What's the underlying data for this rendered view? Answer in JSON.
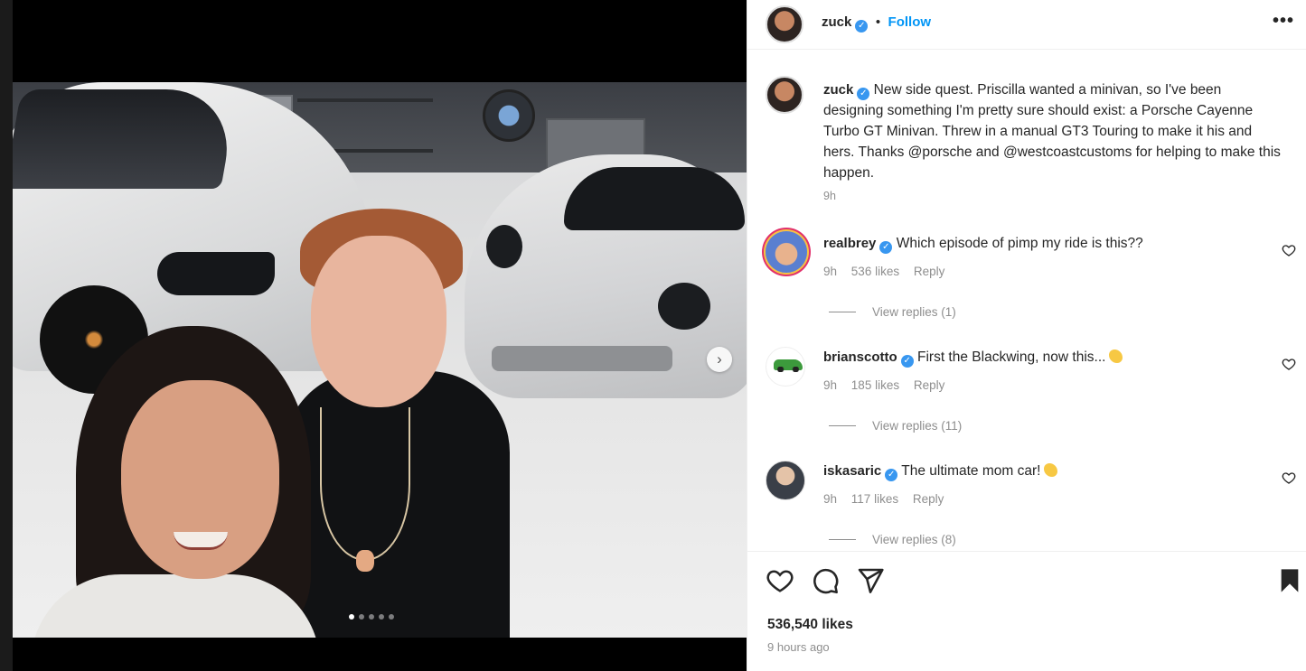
{
  "post": {
    "author": "zuck",
    "follow_separator": "•",
    "follow_label": "Follow",
    "more_label": "•••",
    "caption": "New side quest. Priscilla wanted a minivan, so I've been designing something I'm pretty sure should exist: a Porsche Cayenne Turbo GT Minivan. Threw in a manual GT3 Touring to make it his and hers. Thanks @porsche and @westcoastcustoms for helping to make this happen.",
    "caption_time": "9h",
    "likes": "536,540 likes",
    "time_ago": "9 hours ago"
  },
  "carousel": {
    "next_label": "›",
    "dot_count": 5,
    "active_index": 0
  },
  "comments": [
    {
      "user": "realbrey",
      "text": "Which episode of pimp my ride is this??",
      "time": "9h",
      "likes": "536 likes",
      "reply_label": "Reply",
      "view_replies": "View replies (1)",
      "has_emoji": false
    },
    {
      "user": "brianscotto",
      "text": "First the Blackwing, now this...",
      "time": "9h",
      "likes": "185 likes",
      "reply_label": "Reply",
      "view_replies": "View replies (11)",
      "has_emoji": true
    },
    {
      "user": "iskasaric",
      "text": "The ultimate mom car!",
      "time": "9h",
      "likes": "117 likes",
      "reply_label": "Reply",
      "view_replies": "View replies (8)",
      "has_emoji": true
    }
  ],
  "icons": {
    "verified": "verified-badge-icon",
    "like": "heart-icon",
    "comment": "comment-icon",
    "share": "send-icon",
    "save": "bookmark-icon",
    "carousel_next": "chevron-right-icon"
  },
  "colors": {
    "accent": "#0095f6",
    "verified": "#3897f0",
    "text": "#262626",
    "muted": "#8e8e8e"
  }
}
